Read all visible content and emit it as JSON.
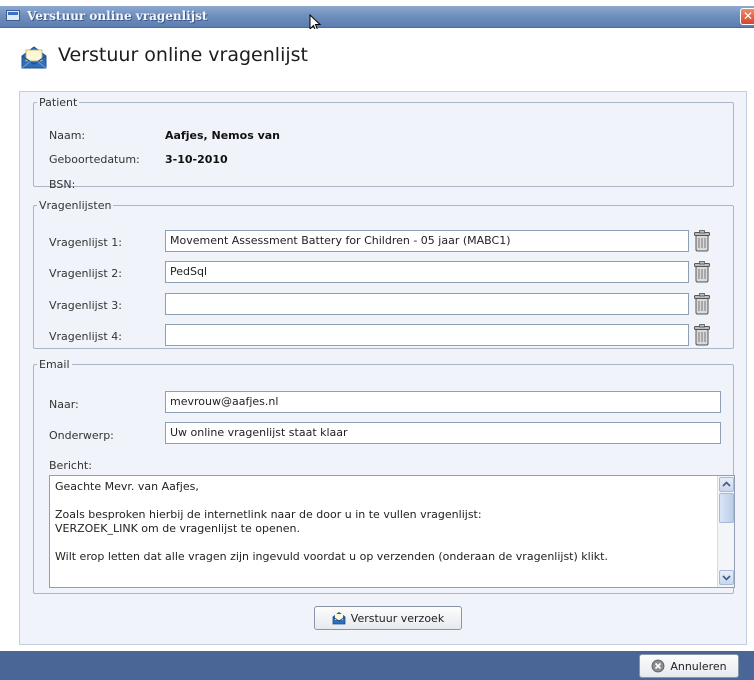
{
  "window": {
    "title": "Verstuur online vragenlijst",
    "close_glyph": "✕"
  },
  "header": {
    "title": "Verstuur online vragenlijst",
    "icon": "envelope-icon"
  },
  "patient": {
    "legend": "Patient",
    "name_label": "Naam:",
    "name_value": "Aafjes, Nemos van",
    "dob_label": "Geboortedatum:",
    "dob_value": "3-10-2010",
    "bsn_label": "BSN:",
    "bsn_value": ""
  },
  "questionnaires": {
    "legend": "Vragenlijsten",
    "items": [
      {
        "label": "Vragenlijst 1:",
        "value": "Movement Assessment Battery for Children - 05 jaar (MABC1)"
      },
      {
        "label": "Vragenlijst 2:",
        "value": "PedSql"
      },
      {
        "label": "Vragenlijst 3:",
        "value": ""
      },
      {
        "label": "Vragenlijst 4:",
        "value": ""
      }
    ],
    "delete_icon": "trash-icon"
  },
  "email": {
    "legend": "Email",
    "to_label": "Naar:",
    "to_value": "mevrouw@aafjes.nl",
    "subject_label": "Onderwerp:",
    "subject_value": "Uw online vragenlijst staat klaar",
    "message_label": "Bericht:",
    "message_lines": [
      "Geachte Mevr.  van Aafjes,",
      "",
      "Zoals besproken hierbij de internetlink naar de door u in te vullen vragenlijst:",
      "VERZOEK_LINK om de vragenlijst te openen.",
      "",
      "Wilt erop letten dat alle vragen zijn ingevuld voordat u op verzenden (onderaan de vragenlijst) klikt."
    ]
  },
  "actions": {
    "send_label": "Verstuur verzoek",
    "cancel_label": "Annuleren"
  },
  "colors": {
    "titlebar": "#6f8fbe",
    "panel_bg": "#f0f4fa",
    "footer": "#4a6697"
  }
}
